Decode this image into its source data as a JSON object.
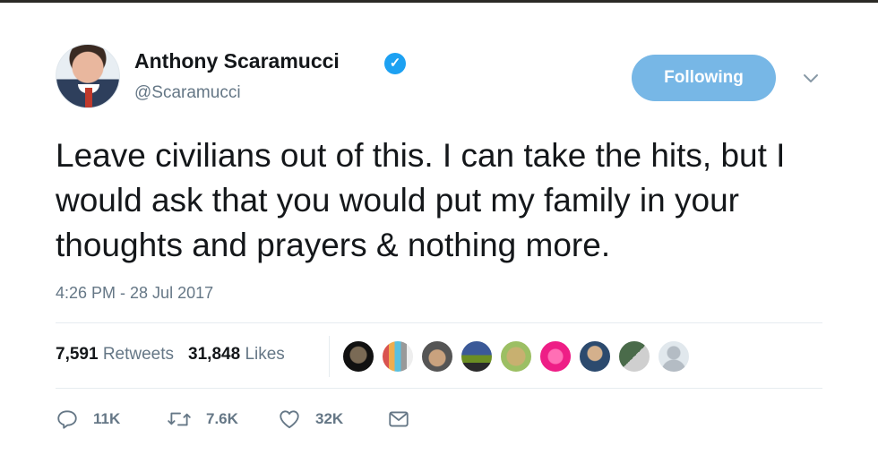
{
  "tweet": {
    "author_name": "Anthony Scaramucci",
    "author_handle": "@Scaramucci",
    "follow_button_label": "Following",
    "text": "Leave civilians out of this. I can take the hits, but I would ask that you would put my family in your thoughts and prayers & nothing more.",
    "timestamp": "4:26 PM - 28 Jul 2017",
    "retweets_count": "7,591",
    "retweets_label": "Retweets",
    "likes_count": "31,848",
    "likes_label": "Likes",
    "liker_avatars": [
      "avatar-dark-face",
      "avatar-colorful",
      "avatar-person-hat",
      "avatar-landscape",
      "avatar-cat",
      "avatar-pink",
      "avatar-person-blue",
      "avatar-group",
      "avatar-default-gray"
    ],
    "actions": {
      "reply_count": "11K",
      "retweet_count": "7.6K",
      "like_count": "32K"
    }
  },
  "icons": {
    "verified": "verified-badge-icon",
    "caret": "chevron-down-icon",
    "reply": "reply-icon",
    "retweet": "retweet-icon",
    "like": "heart-icon",
    "message": "envelope-icon"
  },
  "colors": {
    "accent_blue": "#1da1f2",
    "following_button": "#77b7e6",
    "secondary_text": "#657786",
    "primary_text": "#14171a",
    "divider": "#e6ecf0"
  }
}
